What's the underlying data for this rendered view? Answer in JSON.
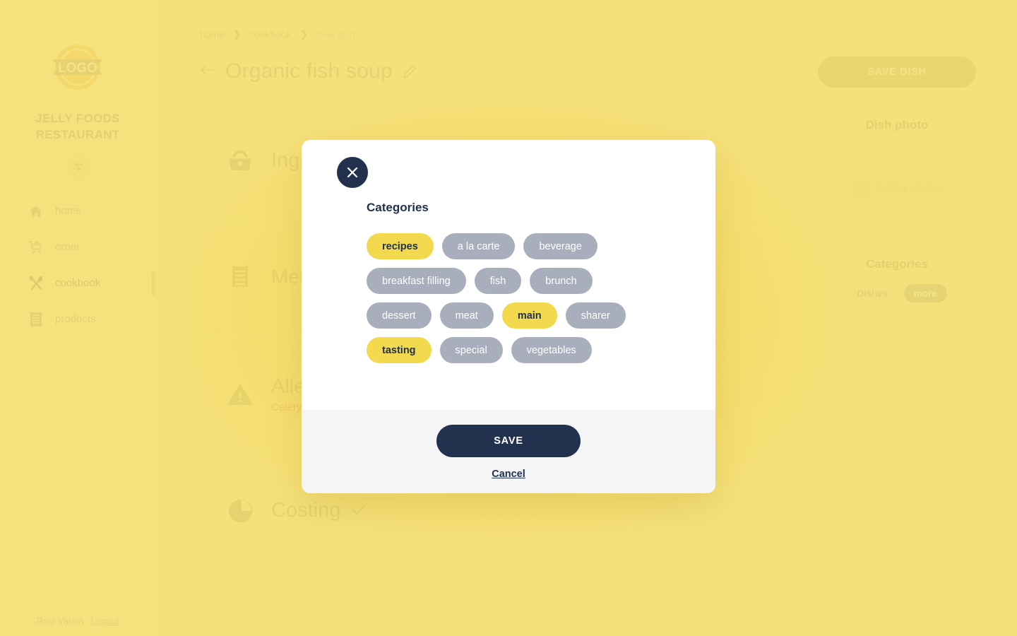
{
  "sidebar": {
    "logo_text": "LOGO",
    "brand_name": "JELLY FOODS RESTAURANT",
    "collapse_icon": "collapse-arrows-icon",
    "items": [
      {
        "label": "home",
        "icon": "home-icon",
        "active": false
      },
      {
        "label": "order",
        "icon": "cart-plus-icon",
        "active": false
      },
      {
        "label": "cookbook",
        "icon": "cutlery-icon",
        "active": true
      },
      {
        "label": "products",
        "icon": "receipt-icon",
        "active": false
      }
    ],
    "user_name": "Raul Varela",
    "logout_label": "Logout"
  },
  "header": {
    "breadcrumb": [
      "home",
      "cookbook",
      "new dish"
    ],
    "separator": "›",
    "back_icon": "arrow-left-icon",
    "title": "Organic fish soup",
    "edit_icon": "pencil-icon"
  },
  "main": {
    "cards": [
      {
        "title": "Ingredients",
        "icon": "basket-icon",
        "subtitle": "",
        "checked": false
      },
      {
        "title": "Method",
        "icon": "receipt-icon",
        "subtitle": "",
        "checked": false
      },
      {
        "title": "Allergens",
        "icon": "warning-icon",
        "subtitle": "Celery, E",
        "checked": false
      },
      {
        "title": "Costing",
        "icon": "pie-chart-icon",
        "subtitle": "",
        "checked": true
      }
    ]
  },
  "rail": {
    "save_dish_label": "SAVE DISH",
    "photo_label": "Dish photo",
    "photo_placeholder": "Add a photo",
    "photo_icon": "image-icon",
    "categories_label": "Categories",
    "chips": [
      {
        "label": "Dishes",
        "selected": true
      },
      {
        "label": "more",
        "selected": false
      }
    ]
  },
  "modal": {
    "close_icon": "close-icon",
    "heading": "Categories",
    "categories": [
      {
        "label": "recipes",
        "selected": true
      },
      {
        "label": "a la carte",
        "selected": false
      },
      {
        "label": "beverage",
        "selected": false
      },
      {
        "label": "breakfast filling",
        "selected": false
      },
      {
        "label": "fish",
        "selected": false
      },
      {
        "label": "brunch",
        "selected": false
      },
      {
        "label": "dessert",
        "selected": false
      },
      {
        "label": "meat",
        "selected": false
      },
      {
        "label": "main",
        "selected": true
      },
      {
        "label": "sharer",
        "selected": false
      },
      {
        "label": "tasting",
        "selected": true
      },
      {
        "label": "special",
        "selected": false
      },
      {
        "label": "vegetables",
        "selected": false
      }
    ],
    "save_label": "SAVE",
    "cancel_label": "Cancel"
  },
  "colors": {
    "background": "#f4e077",
    "chip_selected": "#f2d94e",
    "chip_unselected": "#a9aebc",
    "navy": "#22314e",
    "accent_text": "#cdb95f",
    "allergen_text": "#e09a53"
  }
}
